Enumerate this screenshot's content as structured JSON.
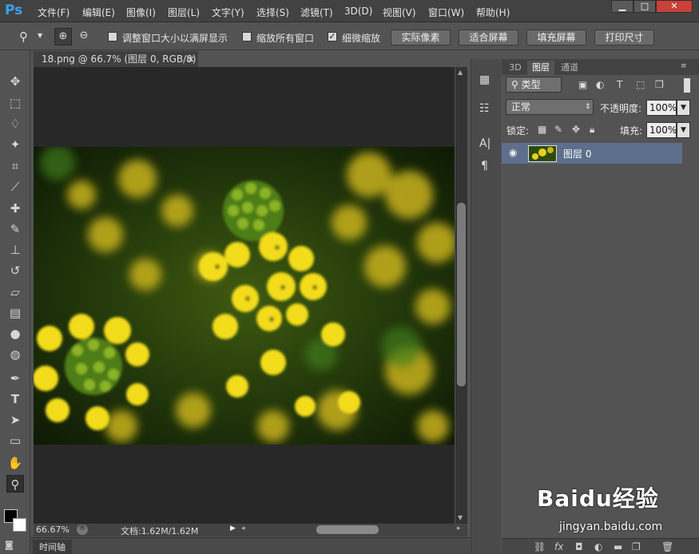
{
  "app": {
    "logo": "Ps"
  },
  "menu": [
    "文件(F)",
    "编辑(E)",
    "图像(I)",
    "图层(L)",
    "文字(Y)",
    "选择(S)",
    "滤镜(T)",
    "3D(D)",
    "视图(V)",
    "窗口(W)",
    "帮助(H)"
  ],
  "window_buttons": [
    "▁",
    "□",
    "✕"
  ],
  "options": {
    "resize_windows": "调整窗口大小以满屏显示",
    "zoom_all": "缩放所有窗口",
    "scrubby": "细微缩放",
    "scrubby_checked": "✓",
    "actual_pixels": "实际像素",
    "fit_screen": "适合屏幕",
    "fill_screen": "填充屏幕",
    "print_size": "打印尺寸"
  },
  "document": {
    "tab_title": "18.png @ 66.7% (图层 0, RGB/8)",
    "tab_close": "×",
    "zoom": "66.67%",
    "doc_info": "文档:1.62M/1.62M"
  },
  "timeline": "时间轴",
  "panel": {
    "tabs": [
      "3D",
      "图层",
      "通道"
    ],
    "filter_kind": "类型",
    "blend_mode": "正常",
    "opacity_label": "不透明度:",
    "opacity_value": "100%",
    "lock_label": "锁定:",
    "fill_label": "填充:",
    "fill_value": "100%",
    "layer_name": "图层 0"
  },
  "watermark": {
    "brand": "Baidu经验",
    "url": "jingyan.baidu.com"
  },
  "colors": {
    "accent": "#3aa2f7",
    "selected_layer": "#5d6f8c",
    "canvas_bg": "#282828"
  }
}
